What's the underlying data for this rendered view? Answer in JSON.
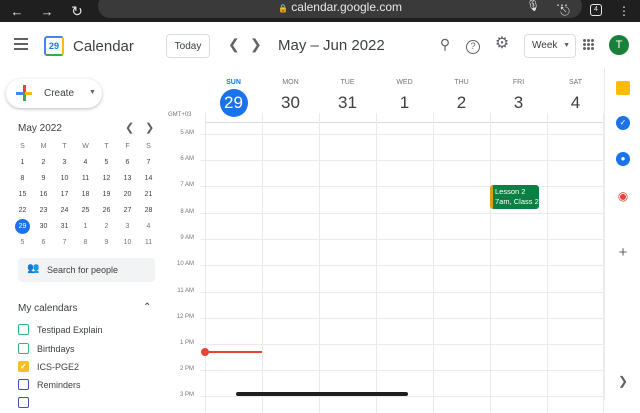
{
  "browser": {
    "url": "calendar.google.com",
    "tabs_count": "4",
    "icons": [
      "back-arrow-icon",
      "forward-arrow-icon",
      "reload-icon",
      "lock-icon",
      "mic-icon",
      "more-icon",
      "share-icon",
      "tabs-icon",
      "more-vertical-icon"
    ]
  },
  "header": {
    "app_title": "Calendar",
    "logo_day": "29",
    "today_label": "Today",
    "range_title": "May – Jun 2022",
    "view_label": "Week",
    "avatar_letter": "T",
    "icons": [
      "menu-icon",
      "chevron-left-icon",
      "chevron-right-icon",
      "search-icon",
      "help-icon",
      "settings-icon",
      "apps-icon"
    ]
  },
  "sidebar": {
    "create_label": "Create",
    "mini_calendar": {
      "title": "May 2022",
      "weekday_headers": [
        "S",
        "M",
        "T",
        "W",
        "T",
        "F",
        "S"
      ],
      "weeks": [
        [
          "1",
          "2",
          "3",
          "4",
          "5",
          "6",
          "7"
        ],
        [
          "8",
          "9",
          "10",
          "11",
          "12",
          "13",
          "14"
        ],
        [
          "15",
          "16",
          "17",
          "18",
          "19",
          "20",
          "21"
        ],
        [
          "22",
          "23",
          "24",
          "25",
          "26",
          "27",
          "28"
        ],
        [
          "29",
          "30",
          "31",
          "1",
          "2",
          "3",
          "4"
        ],
        [
          "5",
          "6",
          "7",
          "8",
          "9",
          "10",
          "11"
        ]
      ],
      "today": "29"
    },
    "people_search_placeholder": "Search for people",
    "my_calendars_title": "My calendars",
    "calendars": [
      {
        "label": "Testipad Explain",
        "color": "#33b679",
        "checked": false
      },
      {
        "label": "Birthdays",
        "color": "#33b679",
        "checked": false
      },
      {
        "label": "ICS-PGE2",
        "color": "#f6bf26",
        "checked": true
      },
      {
        "label": "Reminders",
        "color": "#3f51b5",
        "checked": false
      }
    ]
  },
  "week": {
    "timezone": "GMT+03",
    "days": [
      {
        "name": "SUN",
        "num": "29",
        "today": true
      },
      {
        "name": "MON",
        "num": "30",
        "today": false
      },
      {
        "name": "TUE",
        "num": "31",
        "today": false
      },
      {
        "name": "WED",
        "num": "1",
        "today": false
      },
      {
        "name": "THU",
        "num": "2",
        "today": false
      },
      {
        "name": "FRI",
        "num": "3",
        "today": false
      },
      {
        "name": "SAT",
        "num": "4",
        "today": false
      }
    ],
    "hours": [
      "5 AM",
      "6 AM",
      "7 AM",
      "8 AM",
      "9 AM",
      "10 AM",
      "11 AM",
      "12 PM",
      "1 PM",
      "2 PM",
      "3 PM"
    ],
    "event": {
      "title": "Lesson 2",
      "detail": "7am, Class 2",
      "day": "FRI",
      "color": "#0b8043"
    }
  },
  "side_panel": {
    "icons": [
      "keep-icon",
      "tasks-icon",
      "contacts-icon",
      "maps-icon",
      "add-icon",
      "expand-icon"
    ]
  },
  "colors": {
    "accent": "#1a73e8",
    "now_line": "#ea4335",
    "browser_bar": "#1f1f1f"
  }
}
